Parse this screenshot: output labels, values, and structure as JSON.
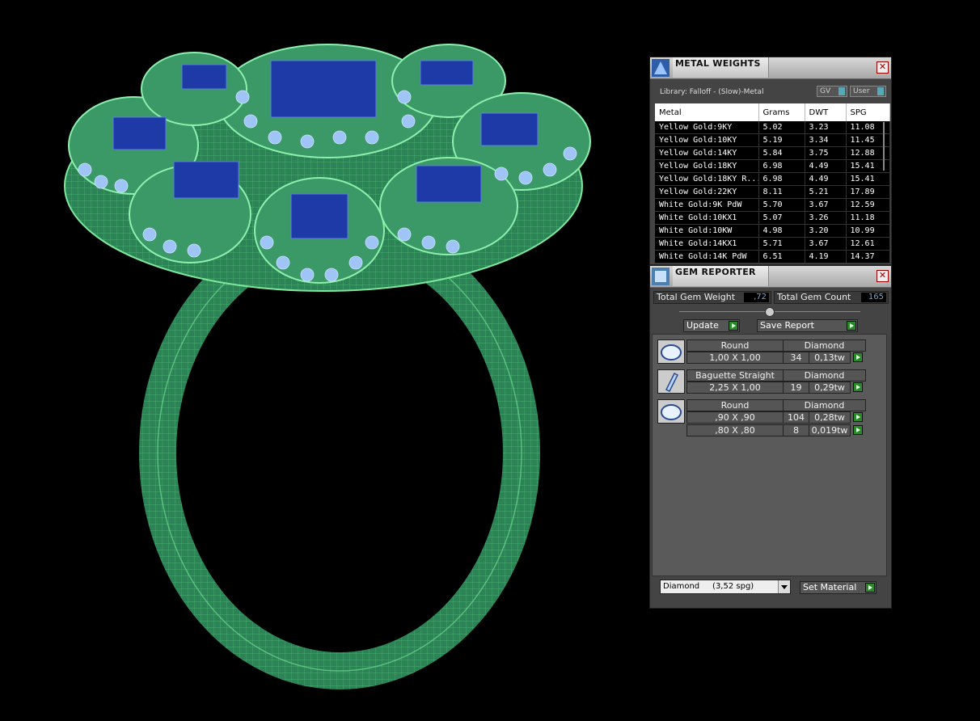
{
  "metal_weights": {
    "title": "METAL WEIGHTS",
    "library": "Library: Falloff - (Slow)-Metal",
    "toggle_gv": "GV",
    "toggle_user": "User",
    "columns": [
      "Metal",
      "Grams",
      "DWT",
      "SPG"
    ],
    "rows": [
      [
        "Yellow Gold:9KY",
        "5.02",
        "3.23",
        "11.08"
      ],
      [
        "Yellow Gold:10KY",
        "5.19",
        "3.34",
        "11.45"
      ],
      [
        "Yellow Gold:14KY",
        "5.84",
        "3.75",
        "12.88"
      ],
      [
        "Yellow Gold:18KY",
        "6.98",
        "4.49",
        "15.41"
      ],
      [
        "Yellow Gold:18KY R...",
        "6.98",
        "4.49",
        "15.41"
      ],
      [
        "Yellow Gold:22KY",
        "8.11",
        "5.21",
        "17.89"
      ],
      [
        "White Gold:9K PdW",
        "5.70",
        "3.67",
        "12.59"
      ],
      [
        "White Gold:10KX1",
        "5.07",
        "3.26",
        "11.18"
      ],
      [
        "White Gold:10KW",
        "4.98",
        "3.20",
        "10.99"
      ],
      [
        "White Gold:14KX1",
        "5.71",
        "3.67",
        "12.61"
      ],
      [
        "White Gold:14K PdW",
        "6.51",
        "4.19",
        "14.37"
      ]
    ]
  },
  "gem_reporter": {
    "title": "GEM REPORTER",
    "total_weight_label": "Total Gem Weight",
    "total_weight": ",72",
    "total_count_label": "Total Gem Count",
    "total_count": "165",
    "update_label": "Update",
    "save_label": "Save Report",
    "groups": [
      {
        "shape": "Round",
        "material": "Diamond",
        "icon": "round-gem-icon",
        "rows": [
          {
            "size": "1,00 X 1,00",
            "count": "34",
            "weight": "0,13tw"
          }
        ]
      },
      {
        "shape": "Baguette Straight",
        "material": "Diamond",
        "icon": "baguette-gem-icon",
        "rows": [
          {
            "size": "2,25 X 1,00",
            "count": "19",
            "weight": "0,29tw"
          }
        ]
      },
      {
        "shape": "Round",
        "material": "Diamond",
        "icon": "round-gem-icon",
        "rows": [
          {
            "size": ",90 X ,90",
            "count": "104",
            "weight": "0,28tw"
          },
          {
            "size": ",80 X ,80",
            "count": "8",
            "weight": "0,019tw"
          }
        ]
      }
    ],
    "material_select": "Diamond     (3,52 spg)",
    "set_material_label": "Set Material"
  },
  "colors": {
    "ring": "#2f8a5c",
    "ring_line": "#6bdc8a",
    "gem_light": "#9ec5f5",
    "gem_dark": "#1e3aa6",
    "panel": "#444444"
  }
}
